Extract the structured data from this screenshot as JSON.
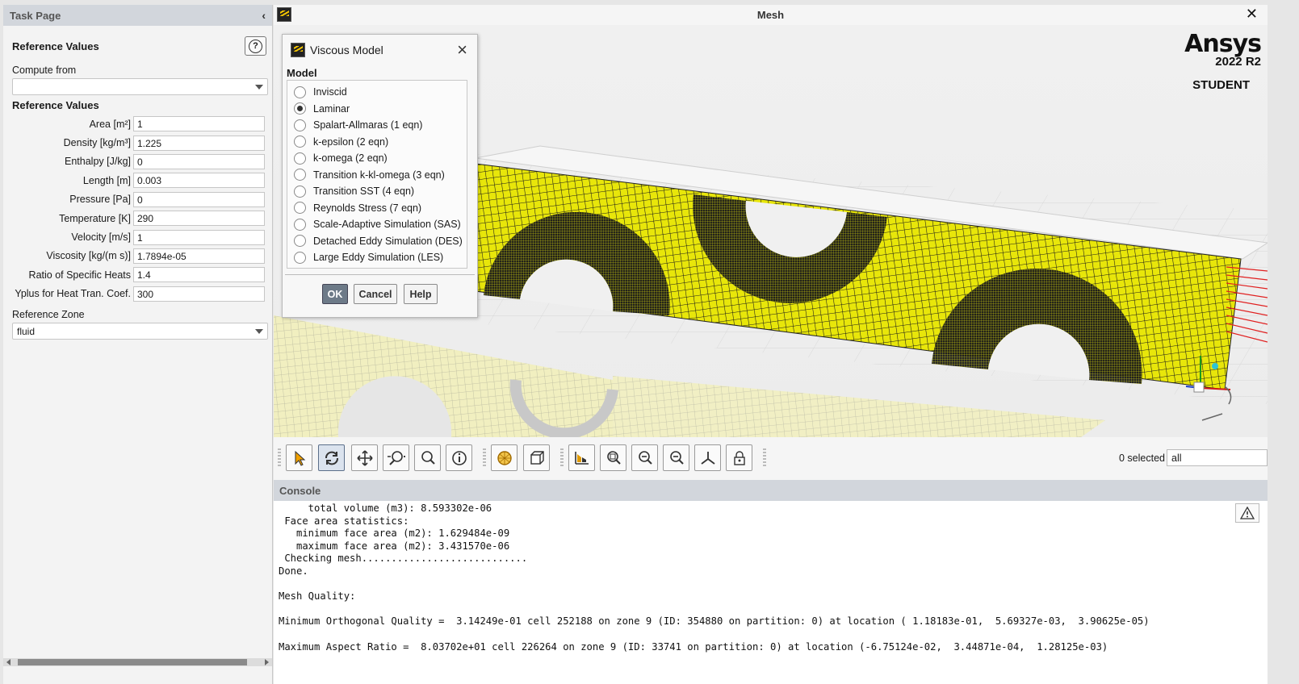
{
  "task_page": {
    "title": "Task Page",
    "heading": "Reference Values",
    "help_symbol": "?",
    "compute_from_label": "Compute from",
    "compute_from_value": "",
    "section_title": "Reference Values",
    "rows": [
      {
        "label": "Area [m²]",
        "value": "1"
      },
      {
        "label": "Density [kg/m³]",
        "value": "1.225"
      },
      {
        "label": "Enthalpy [J/kg]",
        "value": "0"
      },
      {
        "label": "Length [m]",
        "value": "0.003"
      },
      {
        "label": "Pressure [Pa]",
        "value": "0"
      },
      {
        "label": "Temperature [K]",
        "value": "290"
      },
      {
        "label": "Velocity [m/s]",
        "value": "1"
      },
      {
        "label": "Viscosity [kg/(m s)]",
        "value": "1.7894e-05"
      },
      {
        "label": "Ratio of Specific Heats",
        "value": "1.4"
      },
      {
        "label": "Yplus for Heat Tran. Coef.",
        "value": "300"
      }
    ],
    "reference_zone_label": "Reference Zone",
    "reference_zone_value": "fluid"
  },
  "mesh_window": {
    "title": "Mesh",
    "close_symbol": "✕",
    "brand": {
      "name": "Ansys",
      "version": "2022 R2",
      "edition": "STUDENT"
    },
    "mesh_color": "#e8e60a"
  },
  "viscous_dialog": {
    "title": "Viscous Model",
    "group_label": "Model",
    "selected_index": 1,
    "options": [
      "Inviscid",
      "Laminar",
      "Spalart-Allmaras (1 eqn)",
      "k-epsilon (2 eqn)",
      "k-omega (2 eqn)",
      "Transition k-kl-omega (3 eqn)",
      "Transition SST (4 eqn)",
      "Reynolds Stress (7 eqn)",
      "Scale-Adaptive Simulation (SAS)",
      "Detached Eddy Simulation (DES)",
      "Large Eddy Simulation (LES)"
    ],
    "buttons": {
      "ok": "OK",
      "cancel": "Cancel",
      "help": "Help"
    }
  },
  "toolbar": {
    "selected_count": "0 selected",
    "filter_value": "all",
    "icons": [
      "select-arrow-icon",
      "rotate-icon",
      "pan-icon",
      "zoom-icon",
      "zoom-box-icon",
      "probe-info-icon",
      "mesh-sphere-icon",
      "view-cube-icon",
      "fit-plot-icon",
      "zoom-fit-icon",
      "zoom-in-icon",
      "zoom-out-icon",
      "axes-icon",
      "lock-view-icon"
    ]
  },
  "console": {
    "title": "Console",
    "lines": [
      "     total volume (m3): 8.593302e-06",
      " Face area statistics:",
      "   minimum face area (m2): 1.629484e-09",
      "   maximum face area (m2): 3.431570e-06",
      " Checking mesh............................",
      "Done.",
      "",
      "Mesh Quality:",
      "",
      "Minimum Orthogonal Quality =  3.14249e-01 cell 252188 on zone 9 (ID: 354880 on partition: 0) at location ( 1.18183e-01,  5.69327e-03,  3.90625e-05)",
      "",
      "Maximum Aspect Ratio =  8.03702e+01 cell 226264 on zone 9 (ID: 33741 on partition: 0) at location (-6.75124e-02,  3.44871e-04,  1.28125e-03)"
    ]
  }
}
